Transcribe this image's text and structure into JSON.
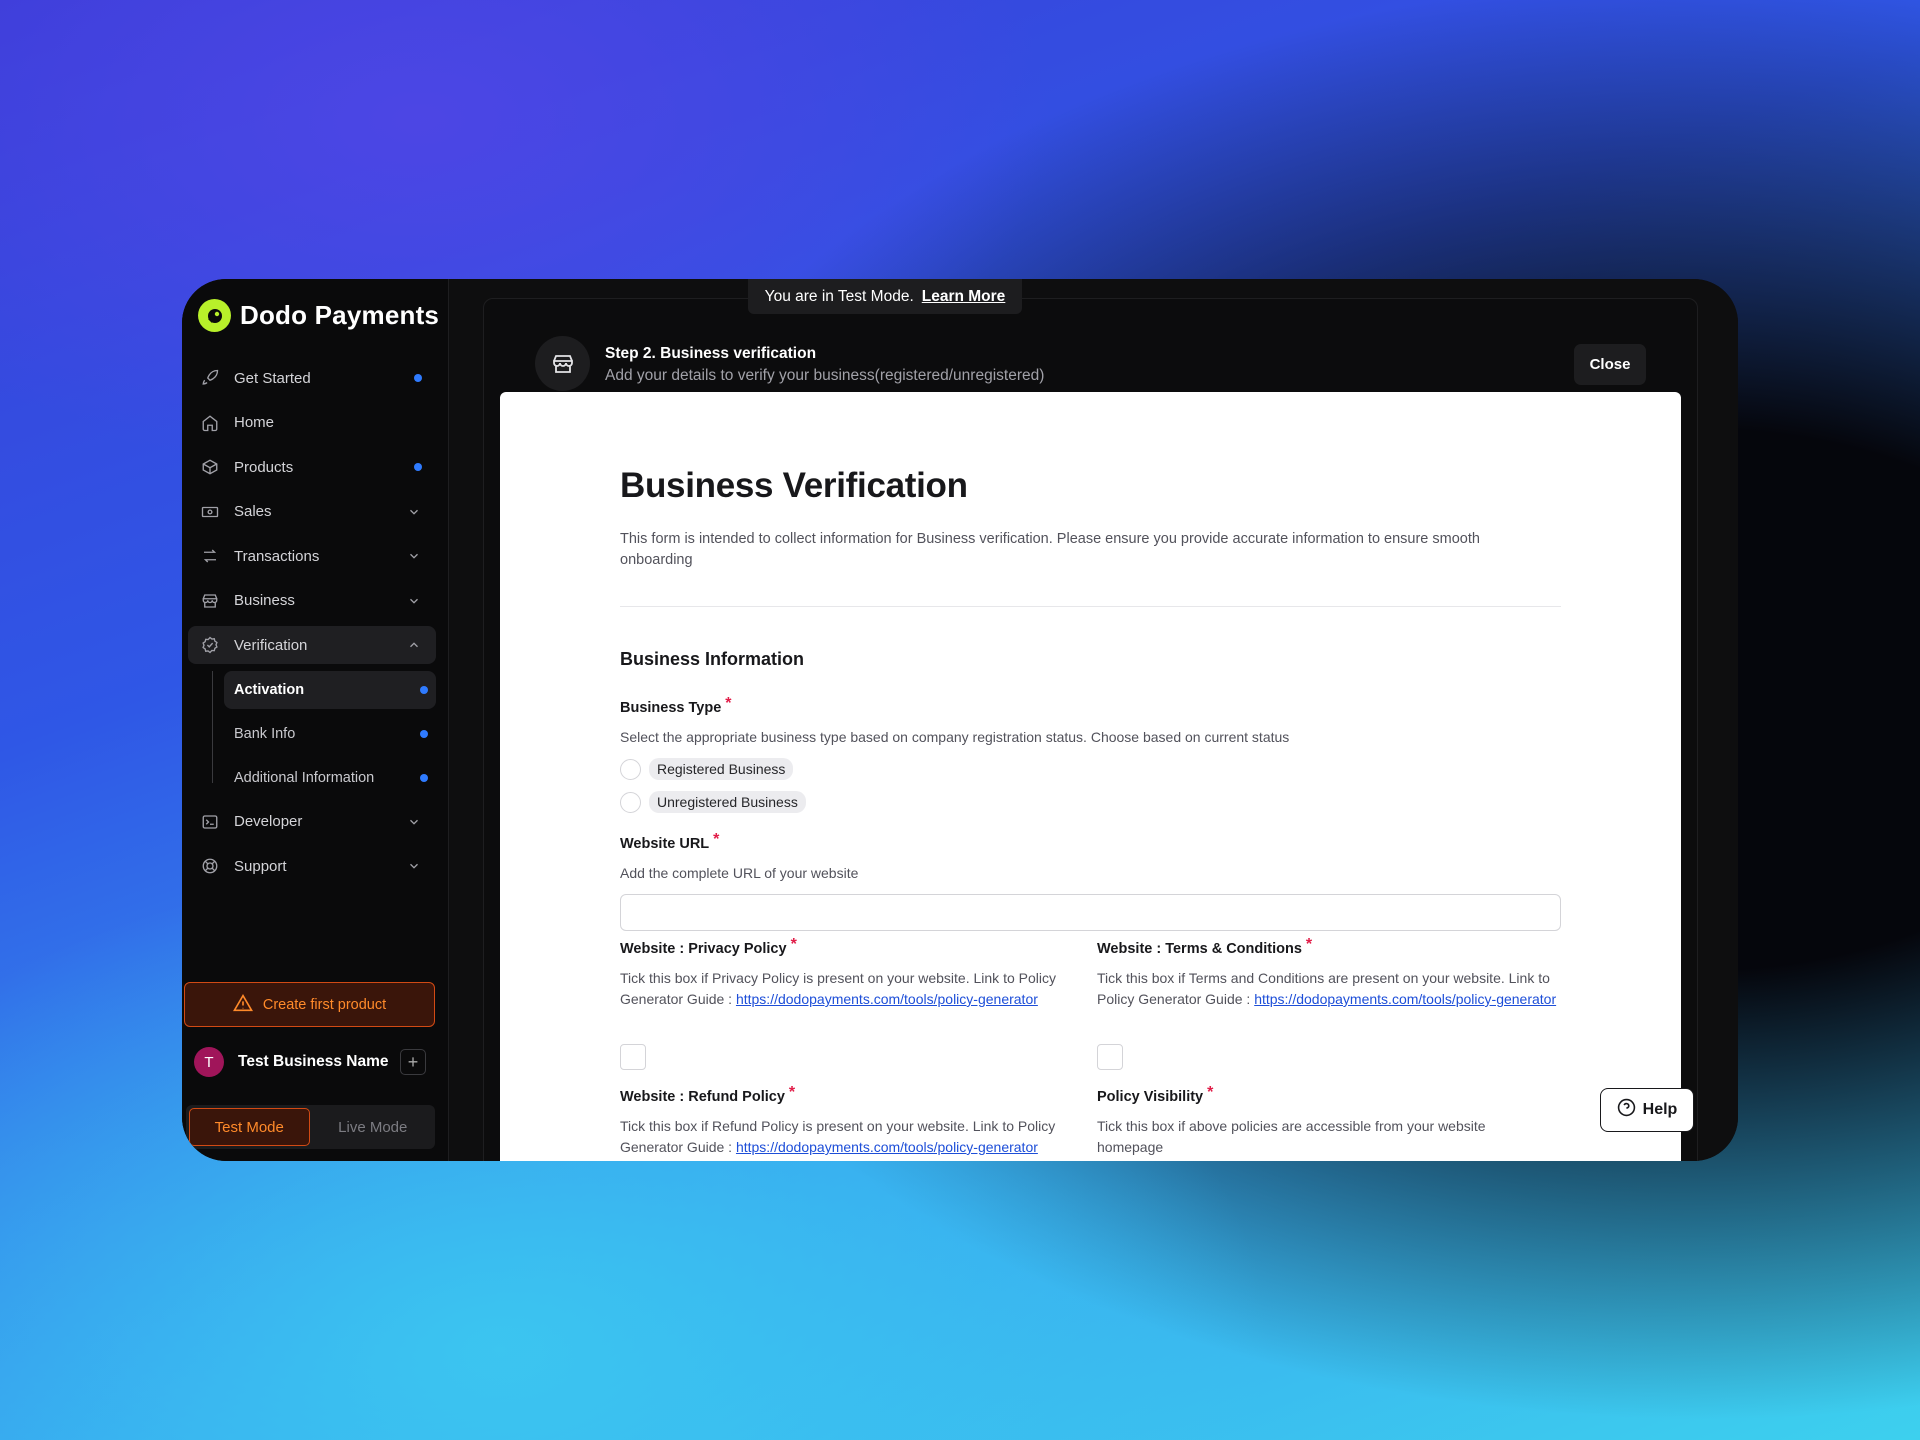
{
  "app": {
    "name": "Dodo Payments"
  },
  "sidebar": {
    "items": [
      {
        "label": "Get Started",
        "icon": "rocket-icon",
        "dot": true,
        "chevron": null
      },
      {
        "label": "Home",
        "icon": "home-icon",
        "dot": false,
        "chevron": null
      },
      {
        "label": "Products",
        "icon": "box-icon",
        "dot": true,
        "chevron": null
      },
      {
        "label": "Sales",
        "icon": "banknote-icon",
        "dot": false,
        "chevron": "down"
      },
      {
        "label": "Transactions",
        "icon": "arrows-icon",
        "dot": false,
        "chevron": "down"
      },
      {
        "label": "Business",
        "icon": "store-icon",
        "dot": false,
        "chevron": "down"
      },
      {
        "label": "Verification",
        "icon": "badge-check-icon",
        "dot": false,
        "chevron": "up"
      }
    ],
    "verification_sub": [
      {
        "label": "Activation",
        "dot": true,
        "active": true
      },
      {
        "label": "Bank Info",
        "dot": true,
        "active": false
      },
      {
        "label": "Additional Information",
        "dot": true,
        "active": false
      }
    ],
    "items_after": [
      {
        "label": "Developer",
        "icon": "terminal-icon",
        "chevron": "down"
      },
      {
        "label": "Support",
        "icon": "lifebuoy-icon",
        "chevron": "down"
      }
    ],
    "create_product_label": "Create first product",
    "business": {
      "avatar_letter": "T",
      "name": "Test Business Name",
      "add_symbol": "+"
    },
    "mode": {
      "test_label": "Test Mode",
      "live_label": "Live Mode",
      "selected": "test"
    }
  },
  "banner": {
    "text": "You are in Test Mode.",
    "link": "Learn More"
  },
  "step": {
    "title": "Step 2. Business verification",
    "subtitle": "Add your details to verify your business(registered/unregistered)",
    "close_label": "Close"
  },
  "form": {
    "title": "Business Verification",
    "description": "This form is intended to collect information for Business verification. Please ensure you provide accurate information to ensure smooth onboarding",
    "section_title": "Business Information",
    "business_type": {
      "label": "Business Type",
      "help": "Select the appropriate business type based on company registration status. Choose based on current status",
      "options": [
        "Registered Business",
        "Unregistered Business"
      ]
    },
    "website_url": {
      "label": "Website URL",
      "help": "Add the complete URL of your website",
      "value": ""
    },
    "privacy_policy": {
      "label": "Website : Privacy Policy",
      "help": "Tick this box if Privacy Policy is present on your website. Link to Policy Generator Guide : ",
      "link": "https://dodopayments.com/tools/policy-generator",
      "checked": false
    },
    "terms": {
      "label": "Website : Terms & Conditions",
      "help": "Tick this box if Terms and Conditions are present on your website. Link to Policy Generator Guide : ",
      "link": "https://dodopayments.com/tools/policy-generator",
      "checked": false
    },
    "refund_policy": {
      "label": "Website : Refund Policy",
      "help": "Tick this box if Refund Policy is present on your website. Link to Policy Generator Guide : ",
      "link": "https://dodopayments.com/tools/policy-generator"
    },
    "policy_visibility": {
      "label": "Policy Visibility",
      "help": "Tick this box if above policies are accessible from your website homepage"
    },
    "required_marker": "*"
  },
  "help_button": {
    "label": "Help"
  },
  "colors": {
    "accent": "#2f7bff",
    "warning": "#ff8a2a",
    "logo": "#b8f02a",
    "required": "#e11d48"
  }
}
